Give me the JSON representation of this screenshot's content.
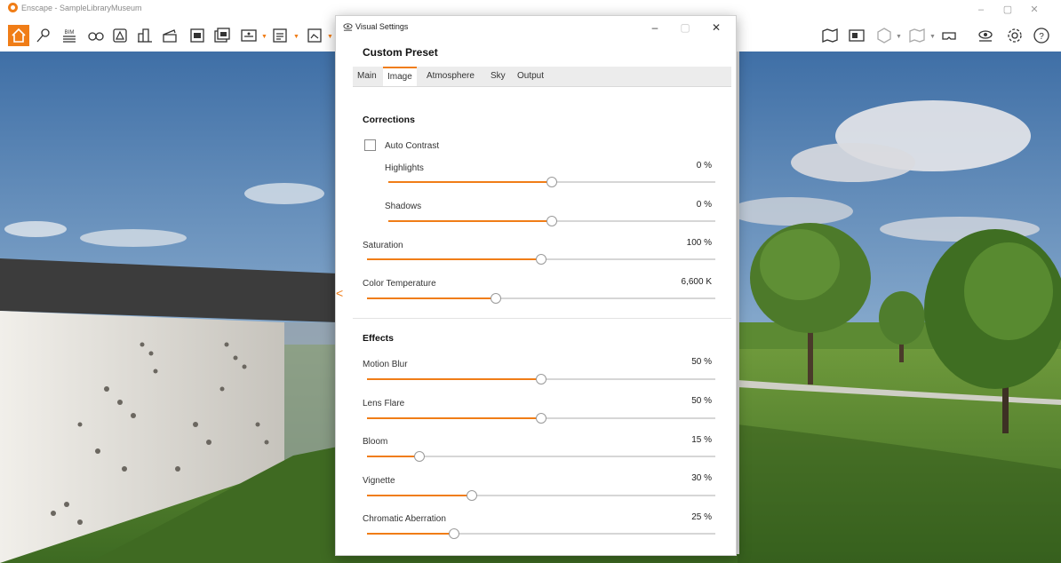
{
  "app": {
    "title": "Enscape - SampleLibraryMuseum",
    "window_controls": [
      "–",
      "▢",
      "✕"
    ]
  },
  "toolbar": {
    "left_icons": [
      "home-icon",
      "sun-pin-icon",
      "bim-icon",
      "binoculars-icon",
      "asset-library-icon",
      "buildings-icon",
      "clapboard-icon",
      "screenshot-icon",
      "batch-render-icon",
      "panorama-360-icon",
      "export-exe-icon"
    ],
    "bim_label": "BIM",
    "right_icons": [
      "map-icon",
      "minimap-icon",
      "cube-view-icon",
      "book-icon",
      "vr-headset-icon",
      "visual-settings-icon",
      "settings-gear-icon",
      "help-icon"
    ],
    "accent": "#f07d17"
  },
  "dialog": {
    "title": "Visual Settings",
    "controls": [
      "–",
      "▢",
      "✕"
    ],
    "preset_name": "Custom Preset",
    "tabs": [
      {
        "label": "Main"
      },
      {
        "label": "Image"
      },
      {
        "label": "Atmosphere"
      },
      {
        "label": "Sky"
      },
      {
        "label": "Output"
      }
    ],
    "active_tab": "Image",
    "corrections": {
      "heading": "Corrections",
      "auto_contrast": {
        "label": "Auto Contrast",
        "checked": false
      },
      "highlights": {
        "label": "Highlights",
        "value": "0 %",
        "level": 0.5
      },
      "shadows": {
        "label": "Shadows",
        "value": "0 %",
        "level": 0.5
      },
      "saturation": {
        "label": "Saturation",
        "value": "100 %",
        "level": 0.5
      },
      "color_temperature": {
        "label": "Color Temperature",
        "value": "6,600 K",
        "level": 0.37
      }
    },
    "effects": {
      "heading": "Effects",
      "motion_blur": {
        "label": "Motion Blur",
        "value": "50 %",
        "level": 0.5
      },
      "lens_flare": {
        "label": "Lens Flare",
        "value": "50 %",
        "level": 0.5
      },
      "bloom": {
        "label": "Bloom",
        "value": "15 %",
        "level": 0.15
      },
      "vignette": {
        "label": "Vignette",
        "value": "30 %",
        "level": 0.3
      },
      "chromatic_aberration": {
        "label": "Chromatic Aberration",
        "value": "25 %",
        "level": 0.25
      }
    },
    "collapse_arrow": "<"
  }
}
